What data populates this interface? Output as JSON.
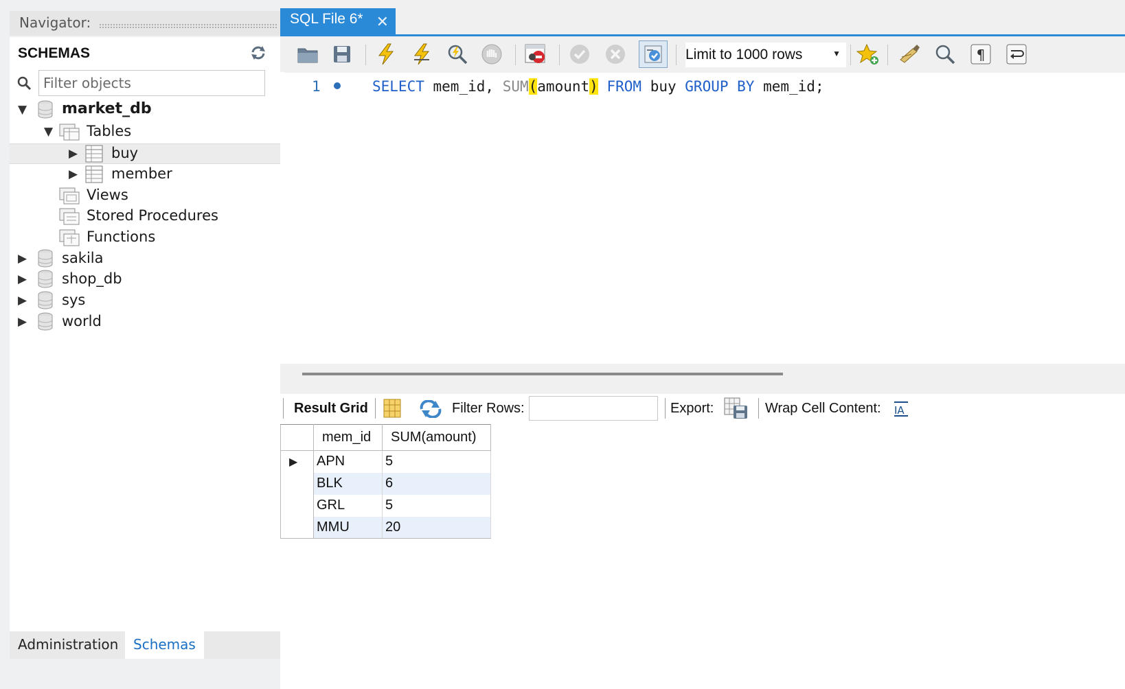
{
  "navigator": {
    "title": "Navigator:",
    "schemas_header": "SCHEMAS",
    "filter_placeholder": "Filter objects",
    "tree": {
      "market_db": "market_db",
      "tables": "Tables",
      "buy": "buy",
      "member": "member",
      "views": "Views",
      "stored_procedures": "Stored Procedures",
      "functions": "Functions",
      "sakila": "sakila",
      "shop_db": "shop_db",
      "sys": "sys",
      "world": "world"
    },
    "bottom_tabs": {
      "administration": "Administration",
      "schemas": "Schemas"
    }
  },
  "editor": {
    "tab_title": "SQL File 6*",
    "limit_label": "Limit to 1000 rows",
    "line_number": "1",
    "code": {
      "select": "SELECT",
      "col": "mem_id,",
      "sum": "SUM",
      "open_paren": "(",
      "arg": "amount",
      "close_paren": ")",
      "from": "FROM",
      "table": "buy",
      "group_by": "GROUP BY",
      "group_col": "mem_id;"
    }
  },
  "results": {
    "result_grid_label": "Result Grid",
    "filter_rows_label": "Filter Rows:",
    "export_label": "Export:",
    "wrap_label": "Wrap Cell Content:",
    "columns": [
      "mem_id",
      "SUM(amount)"
    ],
    "rows": [
      [
        "APN",
        "5"
      ],
      [
        "BLK",
        "6"
      ],
      [
        "GRL",
        "5"
      ],
      [
        "MMU",
        "20"
      ]
    ]
  },
  "colors": {
    "tab_blue": "#2b8ad8",
    "keyword_blue": "#1f5fc9",
    "bracket_highlight": "#ffe40f",
    "alt_row": "#e8f0fb"
  }
}
